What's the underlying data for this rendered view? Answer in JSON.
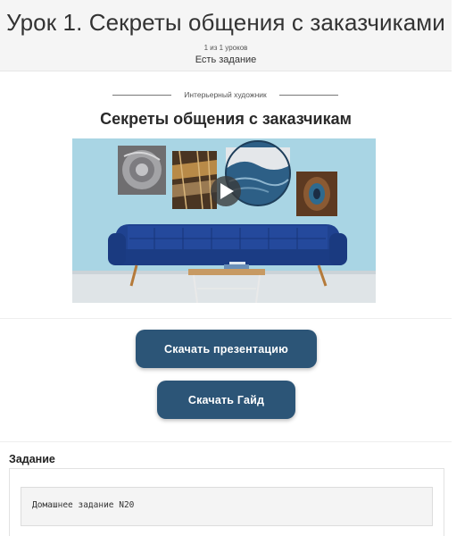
{
  "header": {
    "title": "Урок 1. Секреты общения с заказчиками",
    "counter": "1 из 1 уроков",
    "task_note": "Есть задание"
  },
  "article": {
    "category": "Интерьерный художник",
    "title": "Секреты общения с заказчикам"
  },
  "video": {
    "play_icon": "play-icon"
  },
  "buttons": {
    "presentation": "Скачать презентацию",
    "guide": "Скачать Гайд"
  },
  "task": {
    "heading": "Задание",
    "text": "Домашнее задание N20"
  },
  "colors": {
    "button": "#2c5577",
    "wall": "#a8d4e3",
    "sofa": "#1d3f8a"
  }
}
